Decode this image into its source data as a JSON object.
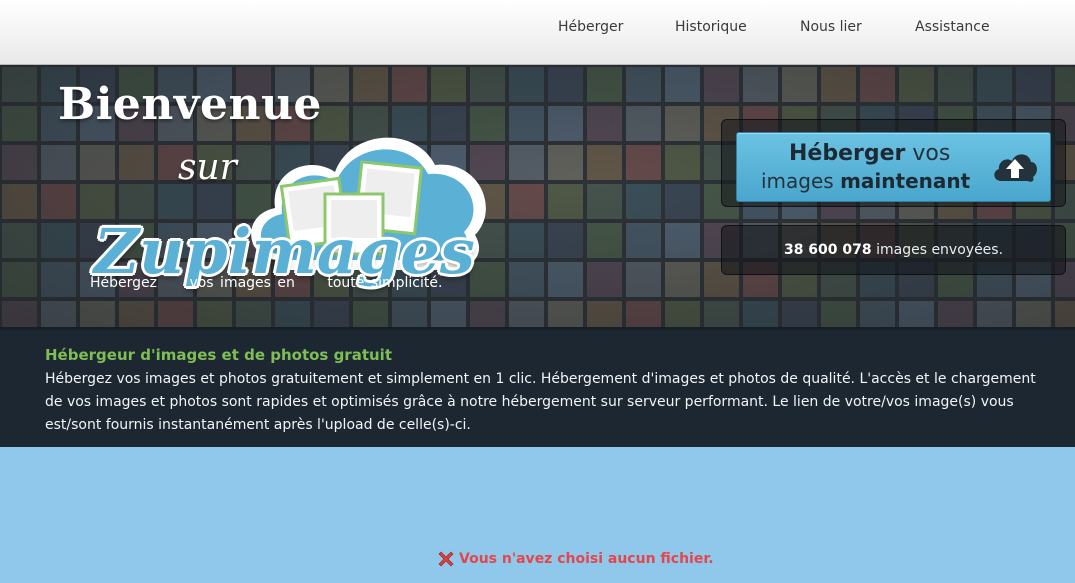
{
  "nav": [
    "Héberger",
    "Historique",
    "Nous lier",
    "Assistance"
  ],
  "hero": {
    "welcome": "Bienvenue",
    "sur": "sur",
    "brand": "Zupimages",
    "tagline": [
      "Hébergez",
      "vos images en",
      "toute simplicité."
    ]
  },
  "cta": {
    "line1_bold": "Héberger",
    "line1_rest": "vos",
    "line2_rest": "images",
    "line2_bold": "maintenant",
    "icon": "cloud-upload-icon"
  },
  "stats": {
    "count": "38 600 078",
    "suffix": "images envoyées."
  },
  "description": {
    "title": "Hébergeur d'images et de photos gratuit",
    "text": "Hébergez vos images et photos gratuitement et simplement en 1 clic. Hébergement d'images et photos de qualité. L'accès et le chargement de vos images et photos sont rapides et optimisés grâce à notre hébergement sur serveur performant. Le lien de votre/vos image(s) vous est/sont fournis instantanément après l'upload de celle(s)-ci."
  },
  "status": {
    "icon": "error-x-icon",
    "message": "Vous n'avez choisi aucun fichier."
  }
}
